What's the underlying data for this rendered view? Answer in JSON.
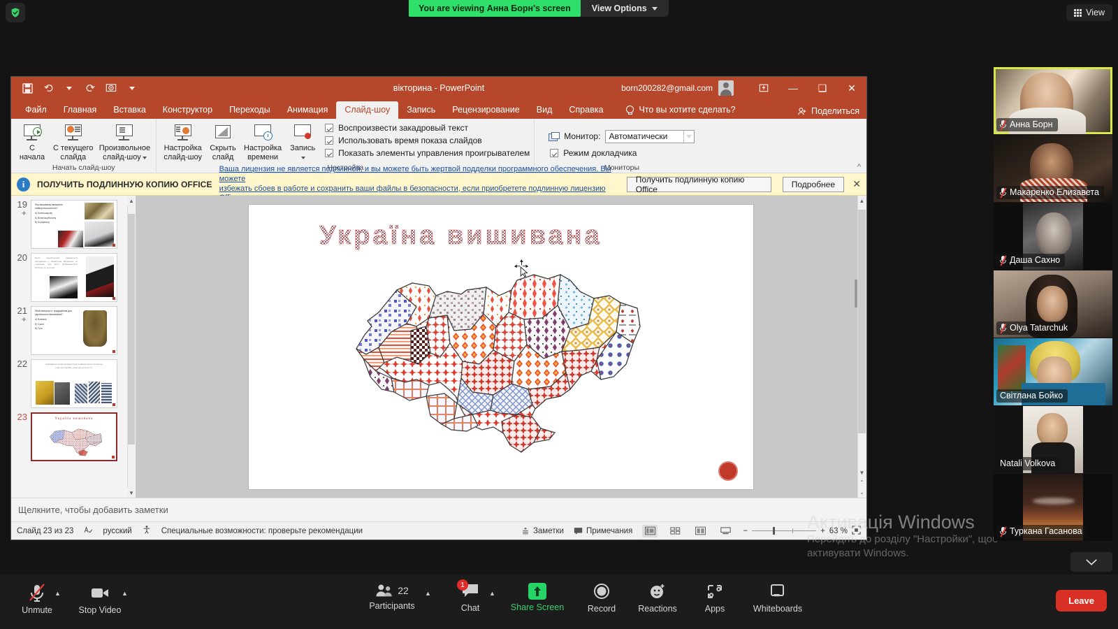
{
  "zoom_topbar": {
    "shield_icon": "shield-check-icon",
    "viewing_banner": "You are viewing Анна Борн's screen",
    "view_options": "View Options",
    "view_button": "View"
  },
  "powerpoint": {
    "title": "вікторина  -  PowerPoint",
    "account_email": "born200282@gmail.com",
    "quick_access": [
      "save-icon",
      "undo-icon",
      "redo-icon",
      "start-presentation-icon",
      "customize-qat-icon"
    ],
    "window_buttons": [
      "ribbon-display-options",
      "minimize",
      "restore",
      "close"
    ],
    "tabs": [
      {
        "label": "Файл",
        "active": false
      },
      {
        "label": "Главная",
        "active": false
      },
      {
        "label": "Вставка",
        "active": false
      },
      {
        "label": "Конструктор",
        "active": false
      },
      {
        "label": "Переходы",
        "active": false
      },
      {
        "label": "Анимация",
        "active": false
      },
      {
        "label": "Слайд-шоу",
        "active": true
      },
      {
        "label": "Запись",
        "active": false
      },
      {
        "label": "Рецензирование",
        "active": false
      },
      {
        "label": "Вид",
        "active": false
      },
      {
        "label": "Справка",
        "active": false
      }
    ],
    "tell_me": "Что вы хотите сделать?",
    "share": "Поделиться",
    "ribbon": {
      "groups": [
        {
          "label": "Начать слайд-шоу",
          "buttons": [
            {
              "line1": "С",
              "line2": "начала",
              "icon": "slideshow-from-start-icon"
            },
            {
              "line1": "С текущего",
              "line2": "слайда",
              "icon": "slideshow-from-current-icon"
            },
            {
              "line1": "Произвольное",
              "line2": "слайд-шоу",
              "icon": "custom-slideshow-icon",
              "dropdown": true
            }
          ]
        },
        {
          "label": "Настройка",
          "buttons": [
            {
              "line1": "Настройка",
              "line2": "слайд-шоу",
              "icon": "setup-slideshow-icon"
            },
            {
              "line1": "Скрыть",
              "line2": "слайд",
              "icon": "hide-slide-icon"
            },
            {
              "line1": "Настройка",
              "line2": "времени",
              "icon": "rehearse-timings-icon"
            },
            {
              "line1": "Запись",
              "line2": "",
              "icon": "record-slideshow-icon",
              "dropdown": true
            }
          ],
          "checkboxes": [
            {
              "label": "Воспроизвести закадровый текст",
              "checked": true
            },
            {
              "label": "Использовать время показа слайдов",
              "checked": true
            },
            {
              "label": "Показать элементы управления проигрывателем",
              "checked": true
            }
          ]
        },
        {
          "label": "Мониторы",
          "monitor_label": "Монитор:",
          "monitor_value": "Автоматически",
          "presenter_view": {
            "label": "Режим докладчика",
            "checked": true
          }
        }
      ],
      "collapse_icon": "collapse-ribbon-icon"
    },
    "license_banner": {
      "info_icon": "info-icon",
      "headline": "ПОЛУЧИТЬ ПОДЛИННУЮ КОПИЮ OFFICE",
      "message_line1": "Ваша лицензия не является подлинной, и вы можете быть жертвой подделки программного обеспечения. Вы можете",
      "message_line2": "избежать сбоев в работе и сохранить ваши файлы в безопасности, если приобретете подлинную лицензию Office.",
      "primary_button": "Получить подлинную копию Office",
      "secondary_button": "Подробнее",
      "close_icon": "close-icon"
    },
    "thumbnails": [
      {
        "number": "19",
        "starred": true,
        "selected": false,
        "title": "Яку вишиванку вважають найкоротшолатною?",
        "options": [
          "А) Багатошарову",
          "Б) Вілянську/Волину",
          "В) Борщівську"
        ]
      },
      {
        "number": "20",
        "starred": false,
        "selected": false,
        "title": "Яким оздобленням вважається вишиванка з барвистим вбранням та тканиною, яка часто прикрашається сріблом та золотом.",
        "options": []
      },
      {
        "number": "21",
        "starred": true,
        "selected": false,
        "title": "Який матеріал є традиційним для українського вишивання?",
        "options": [
          "А) Вовняна",
          "Б) Сукня",
          "В) Гуня"
        ]
      },
      {
        "number": "22",
        "starred": false,
        "selected": false,
        "title": "Найдавніші зразки вишивки були знайдені археологами на території України, вони датуються II ст.",
        "options": []
      },
      {
        "number": "23",
        "starred": false,
        "selected": true,
        "title": "Україна  вишивана",
        "options": []
      }
    ],
    "slide": {
      "title": "Україна   вишивана",
      "badge_icon": "record-indicator-icon",
      "cursor_icon": "move-cursor-icon"
    },
    "notes_placeholder": "Щелкните, чтобы добавить заметки",
    "statusbar": {
      "slide_counter": "Слайд 23 из 23",
      "spellcheck_icon": "spellcheck-icon",
      "language": "русский",
      "accessibility_icon": "accessibility-icon",
      "accessibility": "Специальные возможности: проверьте рекомендации",
      "notes_button": "Заметки",
      "comments_button": "Примечания",
      "views": [
        "normal-view-icon",
        "slide-sorter-icon",
        "reading-view-icon",
        "slideshow-view-icon"
      ],
      "zoom_out_icon": "zoom-out-icon",
      "zoom_in_icon": "zoom-in-icon",
      "zoom_level": "63 %",
      "fit_icon": "fit-to-window-icon"
    }
  },
  "gallery": {
    "participants": [
      {
        "name": "Анна Борн",
        "muted": true,
        "active": true
      },
      {
        "name": "Макаренко Елизавета",
        "muted": true,
        "active": false
      },
      {
        "name": "Даша Сахно",
        "muted": true,
        "active": false
      },
      {
        "name": "Olya Tatarchuk",
        "muted": true,
        "active": false
      },
      {
        "name": "Світлана Бойко",
        "muted": false,
        "active": false
      },
      {
        "name": "Natali Volkova",
        "muted": false,
        "active": false
      },
      {
        "name": "Туркана Гасанова",
        "muted": true,
        "active": false
      }
    ],
    "scroll_down_icon": "chevron-down-icon"
  },
  "windows_watermark": {
    "line1": "Активація Windows",
    "line2": "Перейдіть до розділу \"Настройки\", щоб активувати Windows."
  },
  "zoom_toolbar": {
    "items": [
      {
        "label": "Unmute",
        "icon": "mic-muted-icon",
        "caret": true,
        "accent": false
      },
      {
        "label": "Stop Video",
        "icon": "video-icon",
        "caret": true,
        "accent": false
      },
      {
        "label": "Participants",
        "icon": "participants-icon",
        "caret": true,
        "count": "22",
        "accent": false
      },
      {
        "label": "Chat",
        "icon": "chat-icon",
        "caret": true,
        "badge": "1",
        "accent": false
      },
      {
        "label": "Share Screen",
        "icon": "share-screen-icon",
        "caret": false,
        "accent": true
      },
      {
        "label": "Record",
        "icon": "record-icon",
        "caret": false,
        "accent": false
      },
      {
        "label": "Reactions",
        "icon": "reactions-icon",
        "caret": false,
        "accent": false
      },
      {
        "label": "Apps",
        "icon": "apps-icon",
        "caret": false,
        "accent": false
      },
      {
        "label": "Whiteboards",
        "icon": "whiteboard-icon",
        "caret": false,
        "accent": false
      }
    ],
    "leave_button": "Leave"
  },
  "colors": {
    "ppt_accent": "#b7472a",
    "zoom_green": "#2ee06a",
    "leave_red": "#d93025",
    "banner_yellow": "#fff6cc",
    "active_speaker": "#d8e84a"
  }
}
